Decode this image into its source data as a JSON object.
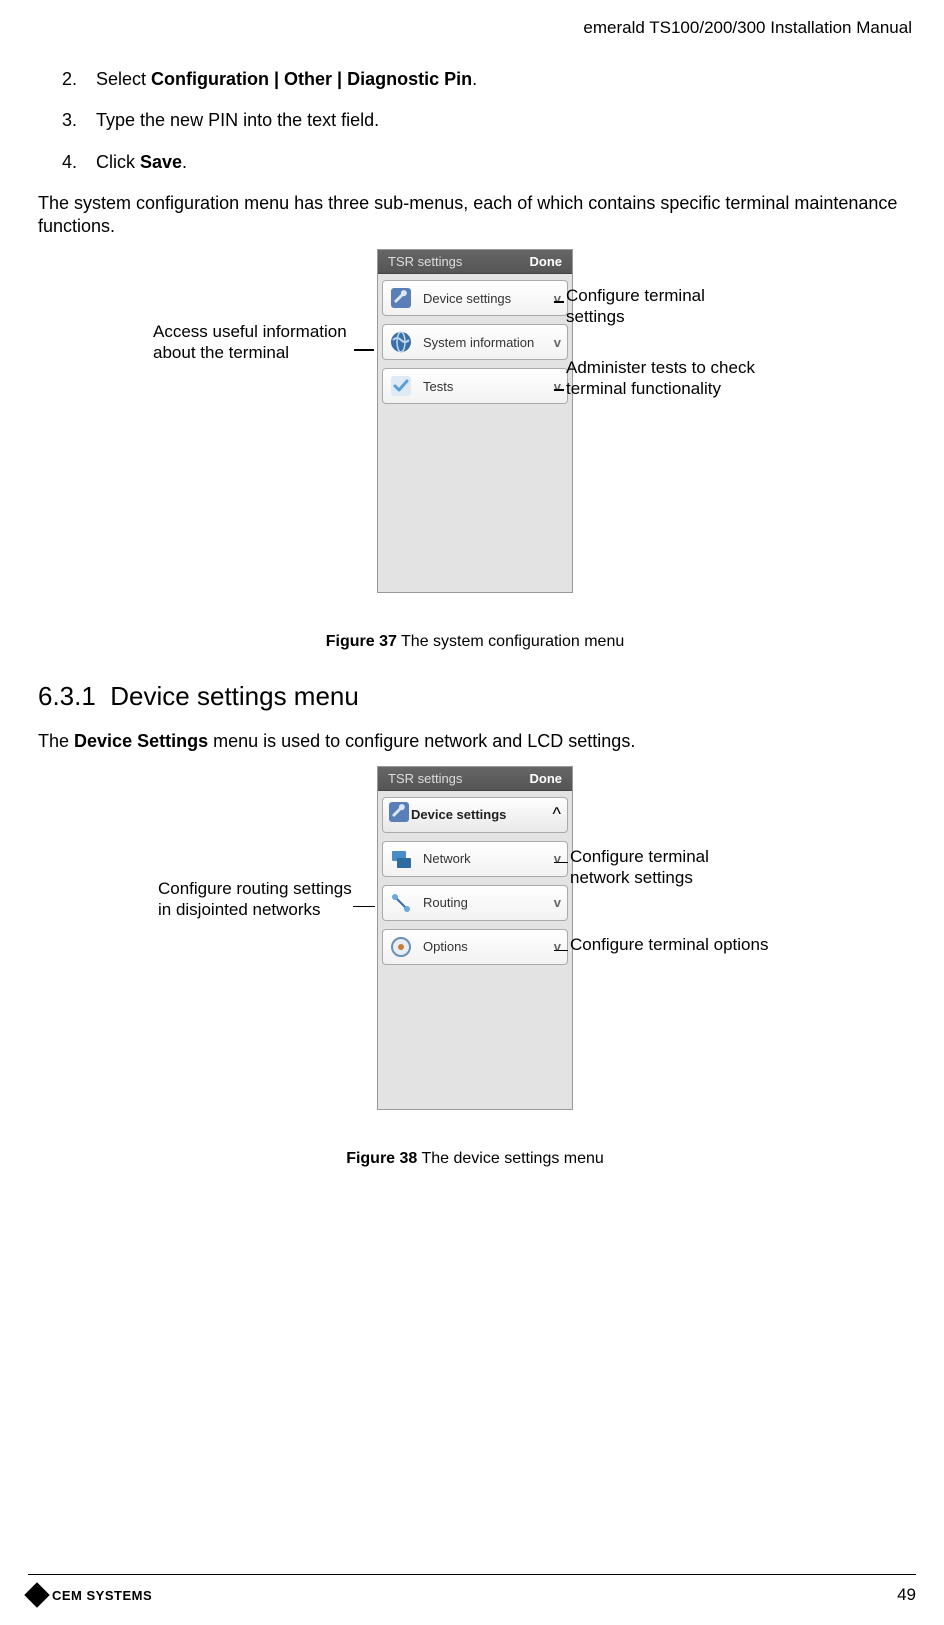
{
  "header": {
    "title": "emerald TS100/200/300 Installation Manual"
  },
  "steps": [
    {
      "num": "2.",
      "pre": "Select ",
      "bold": "Configuration | Other | Diagnostic Pin",
      "post": "."
    },
    {
      "num": "3.",
      "pre": "Type the new PIN into the text field.",
      "bold": "",
      "post": ""
    },
    {
      "num": "4.",
      "pre": "Click ",
      "bold": "Save",
      "post": "."
    }
  ],
  "para1": "The system configuration menu has three sub-menus, each of which contains specific terminal maintenance functions.",
  "fig37": {
    "screen_title": "TSR settings",
    "done": "Done",
    "items": [
      {
        "label": "Device settings",
        "chev": "v"
      },
      {
        "label": "System information",
        "chev": "v"
      },
      {
        "label": "Tests",
        "chev": "v"
      }
    ],
    "callout_left": "Access useful information about the terminal",
    "callout_r1": "Configure terminal settings",
    "callout_r2": "Administer tests to check terminal functionality",
    "caption_bold": "Figure 37",
    "caption_rest": " The system configuration menu"
  },
  "section": {
    "num": "6.3.1",
    "title": "Device settings menu"
  },
  "para2_pre": "The ",
  "para2_bold": "Device Settings",
  "para2_post": " menu is used to configure network and LCD settings.",
  "fig38": {
    "screen_title": "TSR settings",
    "done": "Done",
    "header_label": "Device settings",
    "header_chev": "^",
    "items": [
      {
        "label": "Network",
        "chev": "v"
      },
      {
        "label": "Routing",
        "chev": "v"
      },
      {
        "label": "Options",
        "chev": "v"
      }
    ],
    "callout_left": "Configure routing settings in disjointed networks",
    "callout_r1": "Configure terminal network settings",
    "callout_r2": "Configure terminal options",
    "caption_bold": "Figure 38",
    "caption_rest": " The device settings menu"
  },
  "footer": {
    "brand": "CEM SYSTEMS",
    "page": "49"
  }
}
